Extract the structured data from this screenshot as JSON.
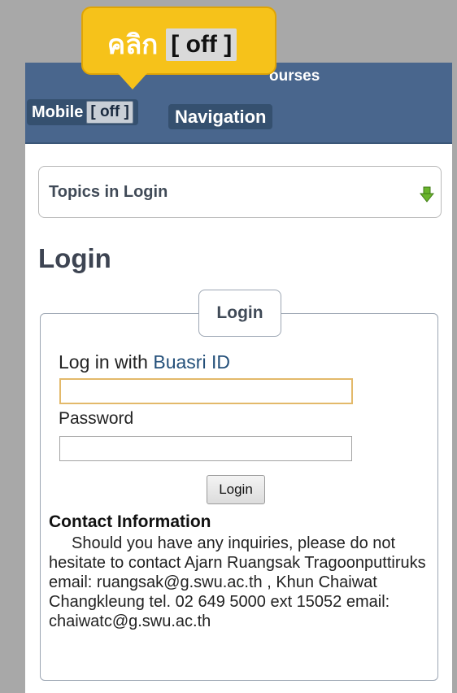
{
  "header": {
    "site_title": "ourses",
    "mobile_label": "Mobile",
    "mobile_state": "[ off ]",
    "nav_label": "Navigation"
  },
  "callout": {
    "text": "คลิก",
    "state": "[ off ]"
  },
  "topics": {
    "label": "Topics in Login",
    "icon": "green-down-arrow-icon"
  },
  "page": {
    "title": "Login"
  },
  "login_box": {
    "legend": "Login",
    "login_prefix": "Log in with ",
    "login_link": "Buasri ID",
    "username_value": "",
    "password_label": "Password",
    "password_value": "",
    "submit_label": "Login"
  },
  "contact": {
    "title": "Contact Information",
    "body": "Should you have any inquiries, please do not hesitate to contact Ajarn Ruangsak Tragoonputtiruks email: ruangsak@g.swu.ac.th , Khun Chaiwat Changkleung tel. 02 649 5000 ext 15052 email: chaiwatc@g.swu.ac.th"
  },
  "colors": {
    "header_bg": "#49668d",
    "callout_bg": "#f6c21a",
    "link": "#24507a"
  }
}
